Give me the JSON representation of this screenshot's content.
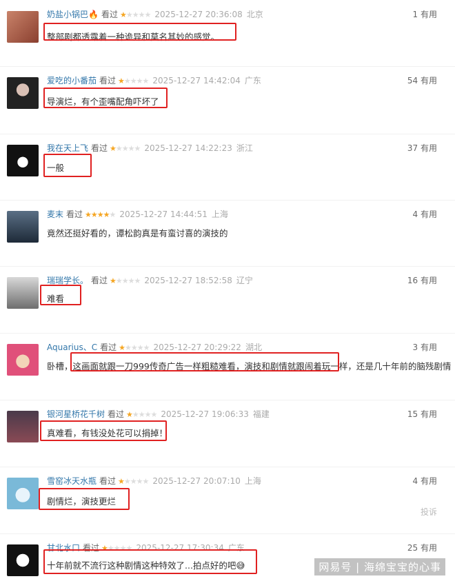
{
  "reviews": [
    {
      "user": "奶盐小锅巴🔥",
      "status": "看过",
      "rating": 1,
      "time": "2025-12-27 20:36:08",
      "location": "北京",
      "useful": "1 有用",
      "comment": "整部剧都透露着一种诡异和莫名其妙的感觉。"
    },
    {
      "user": "爱吃的小番茄",
      "status": "看过",
      "rating": 1,
      "time": "2025-12-27 14:42:04",
      "location": "广东",
      "useful": "54 有用",
      "comment": "导演烂，有个歪嘴配角吓坏了"
    },
    {
      "user": "我在天上飞",
      "status": "看过",
      "rating": 1,
      "time": "2025-12-27 14:22:23",
      "location": "浙江",
      "useful": "37 有用",
      "comment": "一般"
    },
    {
      "user": "麦末",
      "status": "看过",
      "rating": 4,
      "time": "2025-12-27 14:44:51",
      "location": "上海",
      "useful": "4 有用",
      "comment": "竟然还挺好看的，谭松韵真是有蛮讨喜的演技的"
    },
    {
      "user": "瑞瑞学长。",
      "status": "看过",
      "rating": 1,
      "time": "2025-12-27 18:52:58",
      "location": "辽宁",
      "useful": "16 有用",
      "comment": "难看"
    },
    {
      "user": "Aquarius、C",
      "status": "看过",
      "rating": 1,
      "time": "2025-12-27 20:29:22",
      "location": "湖北",
      "useful": "3 有用",
      "comment": "卧槽，这画面就跟一刀999传奇广告一样粗糙难看，演技和剧情就跟闹着玩一样，还是几十年前的脑残剧情"
    },
    {
      "user": "银河星桥花千树",
      "status": "看过",
      "rating": 1,
      "time": "2025-12-27 19:06:33",
      "location": "福建",
      "useful": "15 有用",
      "comment": "真难看，有钱没处花可以捐掉！"
    },
    {
      "user": "雪窑冰天水瓶",
      "status": "看过",
      "rating": 1,
      "time": "2025-12-27 20:07:10",
      "location": "上海",
      "useful": "4 有用",
      "comment": "剧情烂，演技更烂"
    },
    {
      "user": "甘北水口",
      "status": "看过",
      "rating": 1,
      "time": "2025-12-27 17:30:34",
      "location": "广东",
      "useful": "25 有用",
      "comment": "十年前就不流行这种剧情这种特效了...拍点好的吧😅"
    }
  ],
  "report_label": "投诉",
  "watermark": "网易号 | 海绵宝宝的心事",
  "colors": {
    "highlight": "#e02020",
    "username": "#3377aa",
    "star": "#f5a623"
  }
}
